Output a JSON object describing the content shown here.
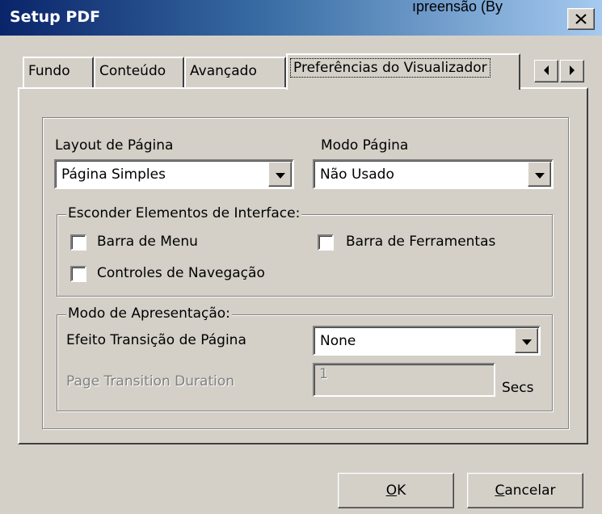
{
  "window": {
    "title": "Setup PDF",
    "top_right_text": "ıpreensão (By"
  },
  "tabs": [
    {
      "label": "Fundo",
      "active": false
    },
    {
      "label": "Conteúdo",
      "active": false
    },
    {
      "label": "Avançado",
      "active": false
    },
    {
      "label": "Preferências do Visualizador",
      "active": true
    }
  ],
  "tab_scroll": {
    "left_icon": "arrow-left-icon",
    "right_icon": "arrow-right-icon"
  },
  "page_layout": {
    "label": "Layout de Página",
    "value": "Página Simples"
  },
  "page_mode": {
    "label": "Modo Página",
    "value": "Não Usado"
  },
  "hide_ui": {
    "title": "Esconder Elementos de Interface:",
    "menu_bar": {
      "label": "Barra de Menu",
      "checked": false
    },
    "toolbar": {
      "label": "Barra de Ferramentas",
      "checked": false
    },
    "nav_controls": {
      "label": "Controles de Navegação",
      "checked": false
    }
  },
  "presentation": {
    "title": "Modo de Apresentação:",
    "transition_label": "Efeito Transição de Página",
    "transition_value": "None",
    "duration_label": "Page Transition Duration",
    "duration_value": "1",
    "duration_unit": "Secs"
  },
  "buttons": {
    "ok_mnemonic": "O",
    "ok_rest": "K",
    "cancel_mnemonic": "C",
    "cancel_rest": "ancelar"
  },
  "colors": {
    "face": "#d4d0c8",
    "title_start": "#0a246a",
    "title_end": "#a6caf0",
    "disabled_text": "#808080"
  }
}
